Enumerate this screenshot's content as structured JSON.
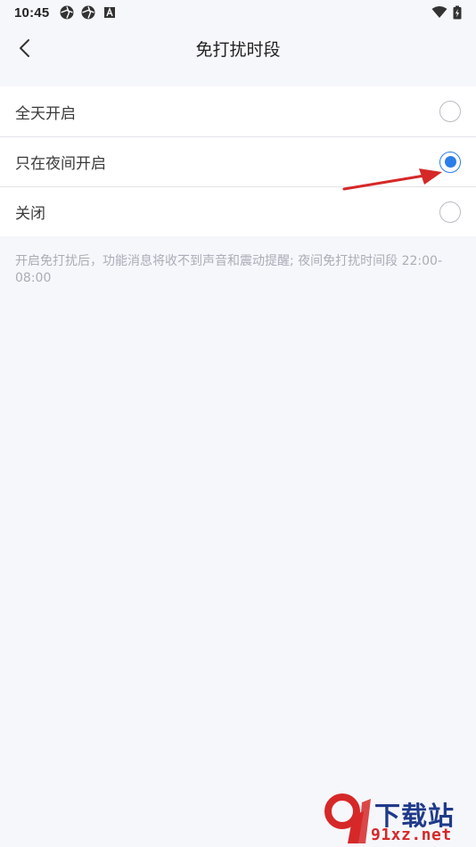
{
  "status_bar": {
    "time": "10:45",
    "left_icons": [
      "aperture-icon",
      "aperture-icon",
      "font-a-icon"
    ],
    "right_icons": [
      "wifi-icon",
      "battery-charging-icon"
    ]
  },
  "header": {
    "title": "免打扰时段",
    "back_icon": "chevron-left-icon"
  },
  "options": [
    {
      "label": "全天开启",
      "checked": false
    },
    {
      "label": "只在夜间开启",
      "checked": true
    },
    {
      "label": "关闭",
      "checked": false
    }
  ],
  "hint": "开启免打扰后，功能消息将收不到声音和震动提醒; 夜间免打扰时间段 22:00-08:00",
  "watermark": {
    "top_text": "下载站",
    "bottom_text": "91xz.net"
  },
  "colors": {
    "accent": "#2b7de9",
    "background": "#f6f7fb",
    "annotation_arrow": "#d62828"
  }
}
